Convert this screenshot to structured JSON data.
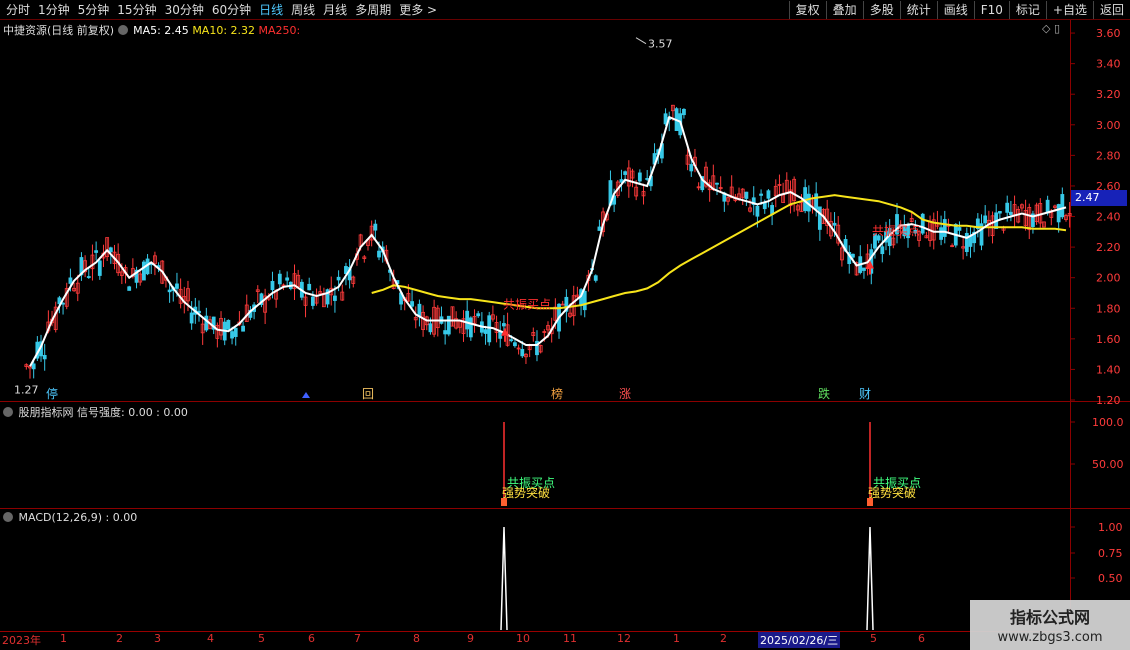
{
  "toolbar": {
    "periods": [
      "分时",
      "1分钟",
      "5分钟",
      "15分钟",
      "30分钟",
      "60分钟",
      "日线",
      "周线",
      "月线",
      "多周期",
      "更多 >"
    ],
    "active_period": "日线",
    "actions": [
      "复权",
      "叠加",
      "多股",
      "统计",
      "画线",
      "F10",
      "标记",
      "+自选",
      "返回"
    ]
  },
  "main_panel": {
    "title": "中捷资源(日线 前复权)",
    "ma5_label": "MA5: 2.45",
    "ma10_label": "MA10: 2.32",
    "ma250_label": "MA250:",
    "current_price": "2.47",
    "high_label": "3.57",
    "low_label": "1.27",
    "y_ticks": [
      "3.60",
      "3.40",
      "3.20",
      "3.00",
      "2.80",
      "2.60",
      "2.40",
      "2.20",
      "2.00",
      "1.80",
      "1.60",
      "1.40",
      "1.20"
    ],
    "signal_text": "共振买点",
    "event_tags": [
      "停",
      "回",
      "榜",
      "涨",
      "跌",
      "财"
    ]
  },
  "signal_panel": {
    "title": "股朋指标网  信号强度: 0.00  : 0.00",
    "y_ticks": [
      "100.0",
      "50.00"
    ],
    "signals": [
      {
        "label1": "共振买点",
        "label2": "强势突破"
      },
      {
        "label1": "共振买点",
        "label2": "强势突破"
      }
    ]
  },
  "macd_panel": {
    "title": "MACD(12,26,9) : 0.00",
    "y_ticks": [
      "1.00",
      "0.75",
      "0.50"
    ]
  },
  "date_axis": {
    "labels": [
      "2023年",
      "1",
      "2",
      "3",
      "4",
      "5",
      "6",
      "7",
      "8",
      "9",
      "10",
      "11",
      "12",
      "1",
      "2",
      "2025/02/26/三",
      "5",
      "6"
    ]
  },
  "watermark": {
    "line1": "指标公式网",
    "line2": "www.zbgs3.com"
  },
  "colors": {
    "up": "#ff3b3b",
    "down": "#37c9e8",
    "ma5": "#ffffff",
    "ma10": "#f7e41a",
    "ma250": "#ff3030",
    "grid": "#8b0000"
  },
  "chart_data": {
    "type": "line",
    "y_range": [
      1.2,
      3.62
    ],
    "series": [
      {
        "name": "MA5",
        "values": [
          1.42,
          1.55,
          1.72,
          1.86,
          1.98,
          2.05,
          2.1,
          2.18,
          2.1,
          2.0,
          2.05,
          2.1,
          2.04,
          1.93,
          1.84,
          1.78,
          1.72,
          1.66,
          1.65,
          1.7,
          1.78,
          1.84,
          1.9,
          1.94,
          1.95,
          1.9,
          1.88,
          1.9,
          1.94,
          2.05,
          2.2,
          2.28,
          2.18,
          2.0,
          1.86,
          1.76,
          1.72,
          1.72,
          1.72,
          1.72,
          1.7,
          1.68,
          1.67,
          1.64,
          1.6,
          1.56,
          1.56,
          1.62,
          1.74,
          1.82,
          1.88,
          2.05,
          2.35,
          2.55,
          2.64,
          2.62,
          2.6,
          2.8,
          3.05,
          3.02,
          2.78,
          2.64,
          2.58,
          2.55,
          2.52,
          2.5,
          2.48,
          2.5,
          2.54,
          2.56,
          2.52,
          2.46,
          2.4,
          2.3,
          2.18,
          2.08,
          2.1,
          2.2,
          2.28,
          2.34,
          2.35,
          2.33,
          2.3,
          2.3,
          2.28,
          2.26,
          2.3,
          2.35,
          2.38,
          2.4,
          2.42,
          2.4,
          2.42,
          2.44,
          2.46
        ]
      },
      {
        "name": "MA10",
        "values": [
          null,
          null,
          null,
          null,
          null,
          null,
          null,
          null,
          null,
          null,
          null,
          null,
          null,
          null,
          null,
          null,
          null,
          null,
          null,
          null,
          null,
          null,
          null,
          null,
          null,
          null,
          null,
          null,
          null,
          null,
          null,
          1.9,
          1.92,
          1.95,
          1.94,
          1.92,
          1.9,
          1.88,
          1.87,
          1.86,
          1.86,
          1.85,
          1.84,
          1.83,
          1.82,
          1.81,
          1.8,
          1.8,
          1.8,
          1.81,
          1.82,
          1.84,
          1.86,
          1.88,
          1.9,
          1.91,
          1.93,
          1.97,
          2.03,
          2.08,
          2.12,
          2.16,
          2.2,
          2.24,
          2.28,
          2.32,
          2.36,
          2.4,
          2.44,
          2.48,
          2.5,
          2.52,
          2.53,
          2.54,
          2.53,
          2.52,
          2.51,
          2.5,
          2.48,
          2.46,
          2.43,
          2.38,
          2.36,
          2.35,
          2.34,
          2.34,
          2.33,
          2.33,
          2.33,
          2.33,
          2.33,
          2.32,
          2.32,
          2.32,
          2.31
        ]
      }
    ]
  }
}
